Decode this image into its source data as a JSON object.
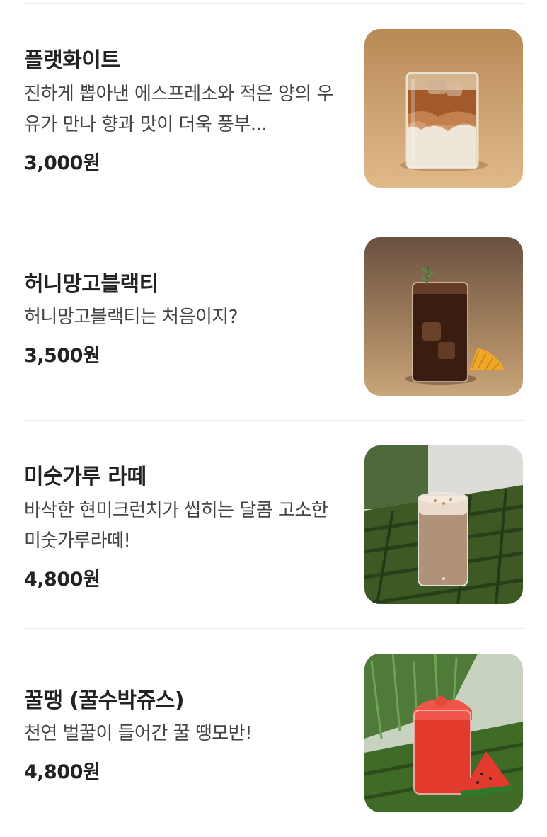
{
  "menu_items": [
    {
      "name": "플랫화이트",
      "description": "진하게 뽑아낸 에스프레소와 적은 양의 우유가 만나 향과 맛이 더욱 풍부...",
      "price": "3,000원",
      "image_icon": "iced-flat-white-glass"
    },
    {
      "name": "허니망고블랙티",
      "description": "허니망고블랙티는 처음이지?",
      "price": "3,500원",
      "image_icon": "iced-black-tea-with-mango"
    },
    {
      "name": "미숫가루 라떼",
      "description": "바삭한 현미크런치가 씹히는 달콤 고소한 미숫가루라떼!",
      "price": "4,800원",
      "image_icon": "misutgaru-latte-cup"
    },
    {
      "name": "꿀땡 (꿀수박쥬스)",
      "description": "천연 벌꿀이 들어간 꿀 땡모반!",
      "price": "4,800원",
      "image_icon": "watermelon-juice-cup"
    }
  ]
}
